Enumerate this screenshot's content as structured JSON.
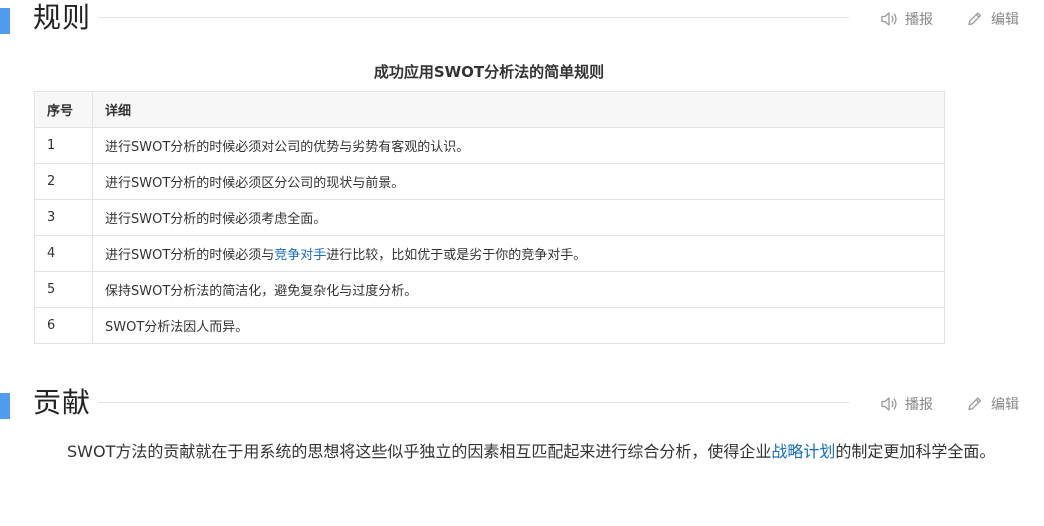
{
  "colors": {
    "accent": "#4f9cee",
    "link": "#136ec2"
  },
  "actions": {
    "play_label": "播报",
    "edit_label": "编辑",
    "play_icon": "speaker-icon",
    "edit_icon": "pencil-icon"
  },
  "rules_section": {
    "title": "规则",
    "table_caption": "成功应用SWOT分析法的简单规则",
    "headers": [
      "序号",
      "详细"
    ],
    "rows": [
      {
        "no": "1",
        "text": "进行SWOT分析的时候必须对公司的优势与劣势有客观的认识。"
      },
      {
        "no": "2",
        "text": "进行SWOT分析的时候必须区分公司的现状与前景。"
      },
      {
        "no": "3",
        "text": "进行SWOT分析的时候必须考虑全面。"
      },
      {
        "no": "4",
        "text_before": "进行SWOT分析的时候必须与",
        "link": "竞争对手",
        "text_after": "进行比较，比如优于或是劣于你的竞争对手。"
      },
      {
        "no": "5",
        "text": "保持SWOT分析法的简洁化，避免复杂化与过度分析。"
      },
      {
        "no": "6",
        "text": "SWOT分析法因人而异。"
      }
    ]
  },
  "contribution_section": {
    "title": "贡献",
    "paragraph_before": "SWOT方法的贡献就在于用系统的思想将这些似乎独立的因素相互匹配起来进行综合分析，使得企业",
    "paragraph_link": "战略计划",
    "paragraph_after": "的制定更加科学全面。"
  }
}
